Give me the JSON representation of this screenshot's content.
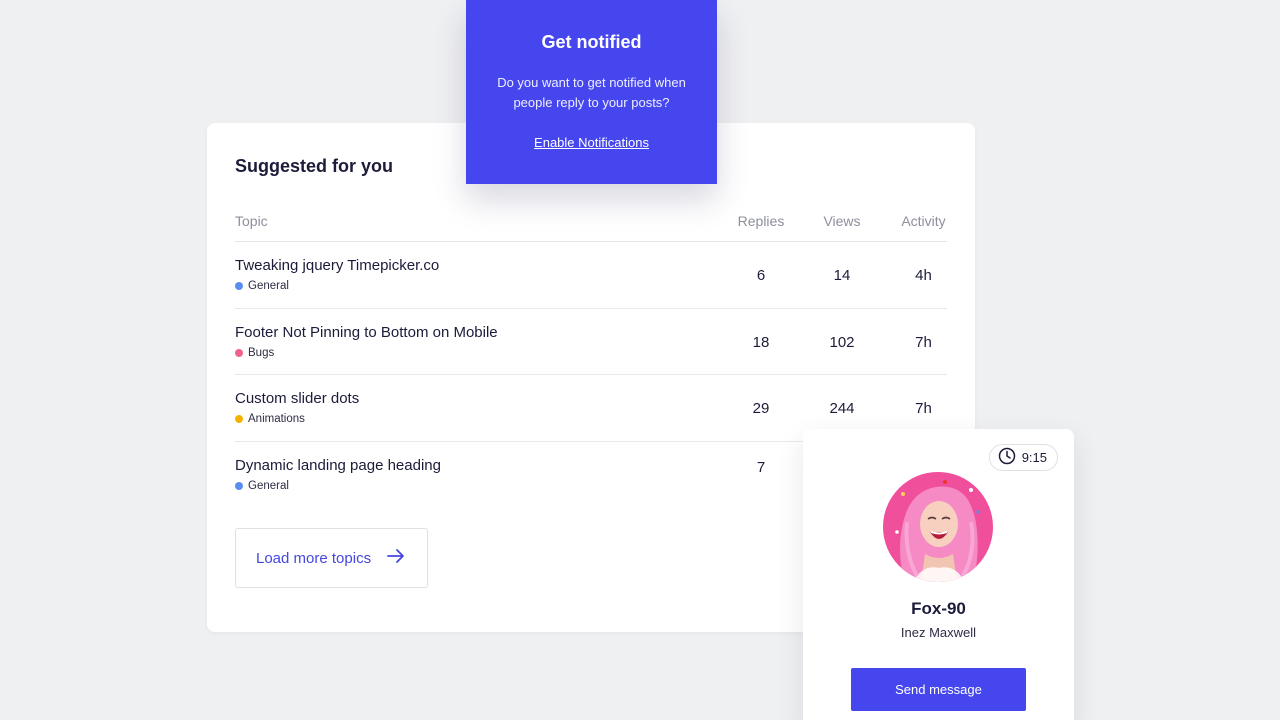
{
  "notify": {
    "title": "Get notified",
    "text": "Do you want to get notified when people reply to your posts?",
    "link": "Enable Notifications"
  },
  "suggested": {
    "title": "Suggested for you",
    "headers": {
      "topic": "Topic",
      "replies": "Replies",
      "views": "Views",
      "activity": "Activity"
    },
    "rows": [
      {
        "title": "Tweaking jquery Timepicker.co",
        "tag": "General",
        "tag_color": "#5b8def",
        "replies": "6",
        "views": "14",
        "activity": "4h"
      },
      {
        "title": "Footer Not Pinning to Bottom on Mobile",
        "tag": "Bugs",
        "tag_color": "#f0648c",
        "replies": "18",
        "views": "102",
        "activity": "7h"
      },
      {
        "title": "Custom slider dots",
        "tag": "Animations",
        "tag_color": "#f5b300",
        "replies": "29",
        "views": "244",
        "activity": "7h"
      },
      {
        "title": "Dynamic landing page heading",
        "tag": "General",
        "tag_color": "#5b8def",
        "replies": "7",
        "views": "",
        "activity": ""
      }
    ],
    "load_more": "Load more topics"
  },
  "profile": {
    "time": "9:15",
    "handle": "Fox-90",
    "name": "Inez Maxwell",
    "button": "Send message"
  },
  "colors": {
    "accent": "#4646ee",
    "background": "#eff0f2"
  },
  "icons": {
    "clock": "clock-icon",
    "arrow": "arrow-right-icon"
  }
}
